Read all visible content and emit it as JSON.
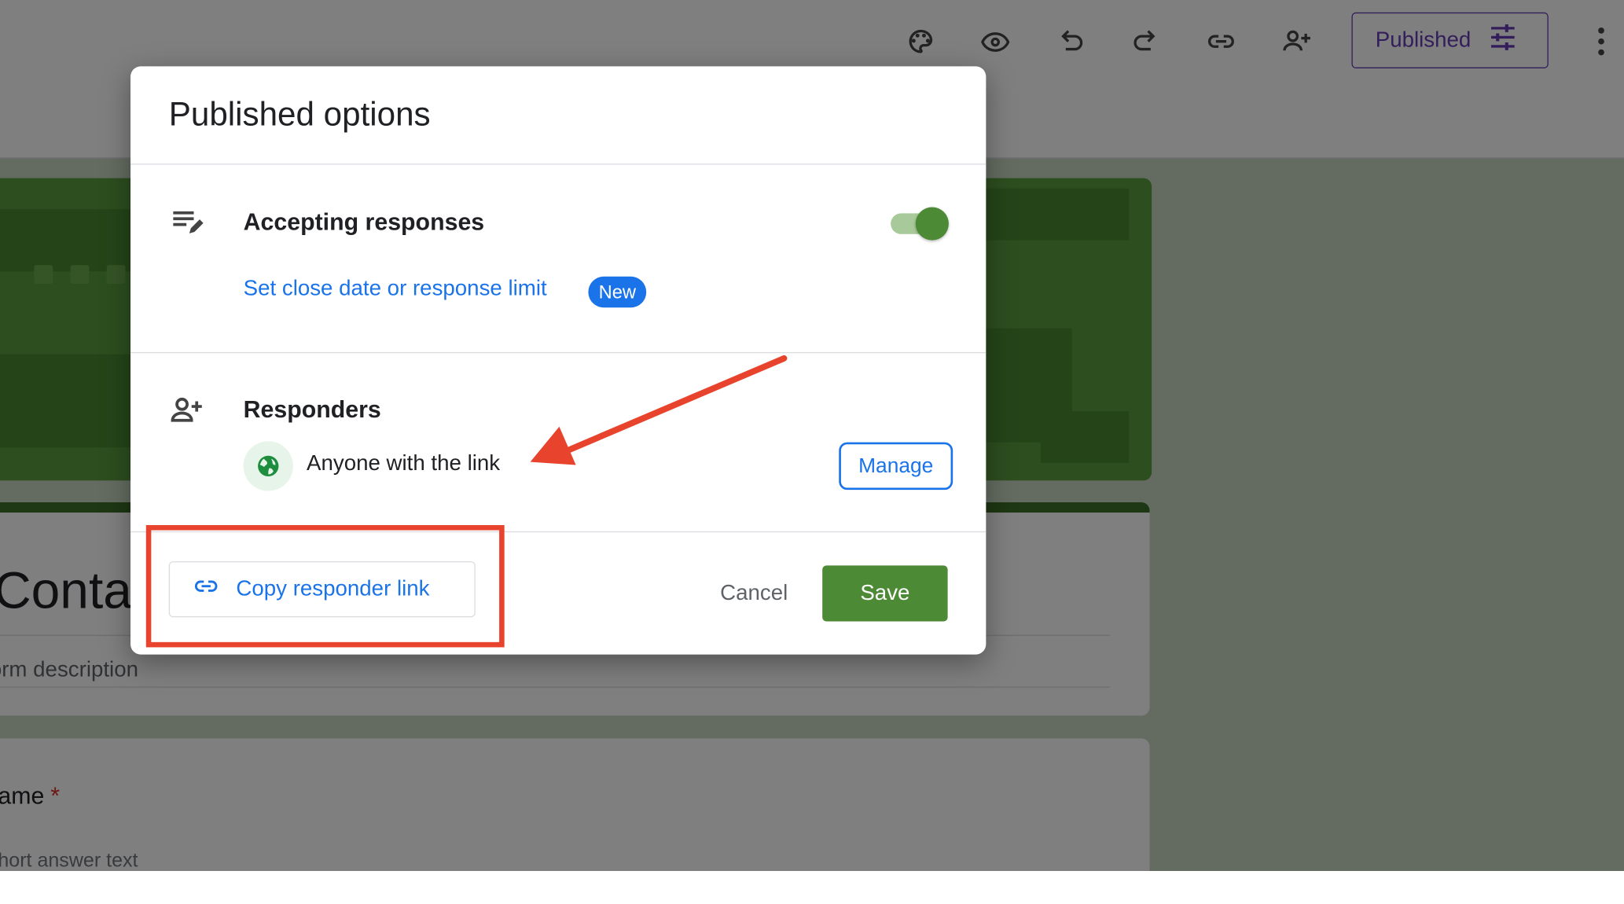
{
  "toolbar": {
    "icons": [
      "palette-icon",
      "preview-icon",
      "undo-icon",
      "redo-icon",
      "link-icon",
      "add-collaborator-icon",
      "more-vert-icon"
    ],
    "published_label": "Published"
  },
  "form": {
    "title": "Contac",
    "description_placeholder": "orm description",
    "question_label": "ame",
    "required_marker": "*",
    "answer_hint": "hort answer text"
  },
  "dialog": {
    "title": "Published options",
    "accepting": {
      "heading": "Accepting responses",
      "toggle_on": true,
      "close_date_link": "Set close date or response limit",
      "new_badge": "New"
    },
    "responders": {
      "heading": "Responders",
      "access_text": "Anyone with the link",
      "manage_label": "Manage"
    },
    "copy_link_label": "Copy responder link",
    "cancel_label": "Cancel",
    "save_label": "Save"
  },
  "colors": {
    "accent_purple": "#673ab7",
    "link_blue": "#1a73e8",
    "green": "#4d8a35",
    "annotation_red": "#e8442d"
  }
}
